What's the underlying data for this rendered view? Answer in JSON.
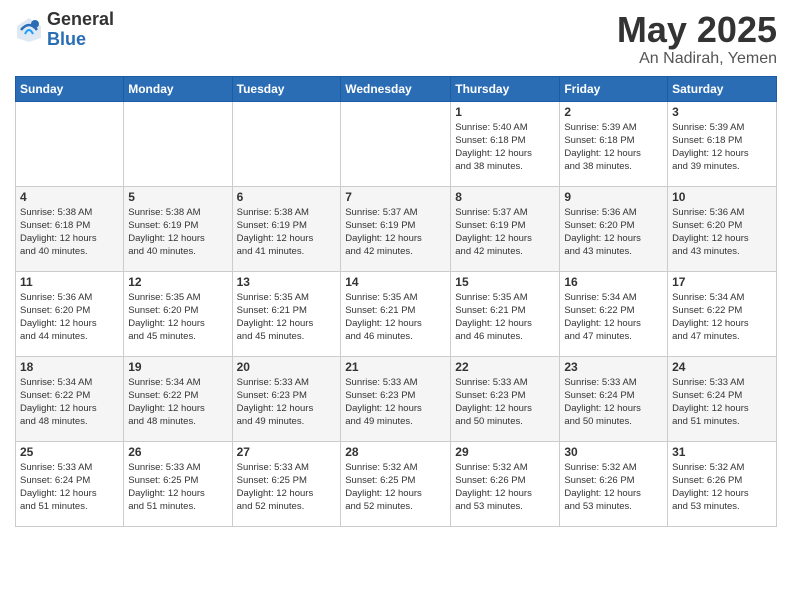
{
  "logo": {
    "general": "General",
    "blue": "Blue"
  },
  "title": "May 2025",
  "location": "An Nadirah, Yemen",
  "days_header": [
    "Sunday",
    "Monday",
    "Tuesday",
    "Wednesday",
    "Thursday",
    "Friday",
    "Saturday"
  ],
  "weeks": [
    [
      {
        "day": "",
        "info": ""
      },
      {
        "day": "",
        "info": ""
      },
      {
        "day": "",
        "info": ""
      },
      {
        "day": "",
        "info": ""
      },
      {
        "day": "1",
        "info": "Sunrise: 5:40 AM\nSunset: 6:18 PM\nDaylight: 12 hours\nand 38 minutes."
      },
      {
        "day": "2",
        "info": "Sunrise: 5:39 AM\nSunset: 6:18 PM\nDaylight: 12 hours\nand 38 minutes."
      },
      {
        "day": "3",
        "info": "Sunrise: 5:39 AM\nSunset: 6:18 PM\nDaylight: 12 hours\nand 39 minutes."
      }
    ],
    [
      {
        "day": "4",
        "info": "Sunrise: 5:38 AM\nSunset: 6:18 PM\nDaylight: 12 hours\nand 40 minutes."
      },
      {
        "day": "5",
        "info": "Sunrise: 5:38 AM\nSunset: 6:19 PM\nDaylight: 12 hours\nand 40 minutes."
      },
      {
        "day": "6",
        "info": "Sunrise: 5:38 AM\nSunset: 6:19 PM\nDaylight: 12 hours\nand 41 minutes."
      },
      {
        "day": "7",
        "info": "Sunrise: 5:37 AM\nSunset: 6:19 PM\nDaylight: 12 hours\nand 42 minutes."
      },
      {
        "day": "8",
        "info": "Sunrise: 5:37 AM\nSunset: 6:19 PM\nDaylight: 12 hours\nand 42 minutes."
      },
      {
        "day": "9",
        "info": "Sunrise: 5:36 AM\nSunset: 6:20 PM\nDaylight: 12 hours\nand 43 minutes."
      },
      {
        "day": "10",
        "info": "Sunrise: 5:36 AM\nSunset: 6:20 PM\nDaylight: 12 hours\nand 43 minutes."
      }
    ],
    [
      {
        "day": "11",
        "info": "Sunrise: 5:36 AM\nSunset: 6:20 PM\nDaylight: 12 hours\nand 44 minutes."
      },
      {
        "day": "12",
        "info": "Sunrise: 5:35 AM\nSunset: 6:20 PM\nDaylight: 12 hours\nand 45 minutes."
      },
      {
        "day": "13",
        "info": "Sunrise: 5:35 AM\nSunset: 6:21 PM\nDaylight: 12 hours\nand 45 minutes."
      },
      {
        "day": "14",
        "info": "Sunrise: 5:35 AM\nSunset: 6:21 PM\nDaylight: 12 hours\nand 46 minutes."
      },
      {
        "day": "15",
        "info": "Sunrise: 5:35 AM\nSunset: 6:21 PM\nDaylight: 12 hours\nand 46 minutes."
      },
      {
        "day": "16",
        "info": "Sunrise: 5:34 AM\nSunset: 6:22 PM\nDaylight: 12 hours\nand 47 minutes."
      },
      {
        "day": "17",
        "info": "Sunrise: 5:34 AM\nSunset: 6:22 PM\nDaylight: 12 hours\nand 47 minutes."
      }
    ],
    [
      {
        "day": "18",
        "info": "Sunrise: 5:34 AM\nSunset: 6:22 PM\nDaylight: 12 hours\nand 48 minutes."
      },
      {
        "day": "19",
        "info": "Sunrise: 5:34 AM\nSunset: 6:22 PM\nDaylight: 12 hours\nand 48 minutes."
      },
      {
        "day": "20",
        "info": "Sunrise: 5:33 AM\nSunset: 6:23 PM\nDaylight: 12 hours\nand 49 minutes."
      },
      {
        "day": "21",
        "info": "Sunrise: 5:33 AM\nSunset: 6:23 PM\nDaylight: 12 hours\nand 49 minutes."
      },
      {
        "day": "22",
        "info": "Sunrise: 5:33 AM\nSunset: 6:23 PM\nDaylight: 12 hours\nand 50 minutes."
      },
      {
        "day": "23",
        "info": "Sunrise: 5:33 AM\nSunset: 6:24 PM\nDaylight: 12 hours\nand 50 minutes."
      },
      {
        "day": "24",
        "info": "Sunrise: 5:33 AM\nSunset: 6:24 PM\nDaylight: 12 hours\nand 51 minutes."
      }
    ],
    [
      {
        "day": "25",
        "info": "Sunrise: 5:33 AM\nSunset: 6:24 PM\nDaylight: 12 hours\nand 51 minutes."
      },
      {
        "day": "26",
        "info": "Sunrise: 5:33 AM\nSunset: 6:25 PM\nDaylight: 12 hours\nand 51 minutes."
      },
      {
        "day": "27",
        "info": "Sunrise: 5:33 AM\nSunset: 6:25 PM\nDaylight: 12 hours\nand 52 minutes."
      },
      {
        "day": "28",
        "info": "Sunrise: 5:32 AM\nSunset: 6:25 PM\nDaylight: 12 hours\nand 52 minutes."
      },
      {
        "day": "29",
        "info": "Sunrise: 5:32 AM\nSunset: 6:26 PM\nDaylight: 12 hours\nand 53 minutes."
      },
      {
        "day": "30",
        "info": "Sunrise: 5:32 AM\nSunset: 6:26 PM\nDaylight: 12 hours\nand 53 minutes."
      },
      {
        "day": "31",
        "info": "Sunrise: 5:32 AM\nSunset: 6:26 PM\nDaylight: 12 hours\nand 53 minutes."
      }
    ]
  ]
}
